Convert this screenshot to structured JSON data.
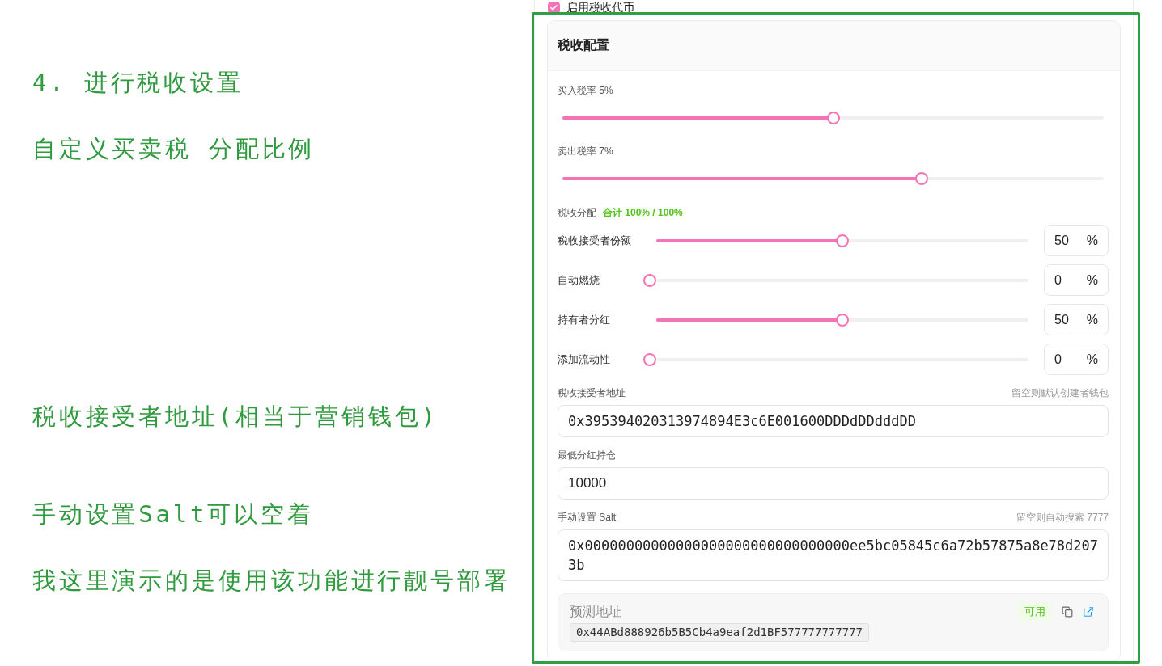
{
  "annotations": [
    "4. 进行税收设置",
    "自定义买卖税 分配比例",
    "税收接受者地址(相当于营销钱包)",
    "手动设置Salt可以空着",
    "我这里演示的是使用该功能进行靓号部署"
  ],
  "enable_tax": {
    "label": "启用税收代币",
    "checked": true
  },
  "tax_config": {
    "title": "税收配置",
    "rates": [
      {
        "label": "买入税率 5%",
        "level": 0.5
      },
      {
        "label": "卖出税率 7%",
        "level": 0.66
      }
    ],
    "distribution": {
      "label": "税收分配",
      "total": "合计 100% / 100%",
      "rows": [
        {
          "label": "税收接受者份额",
          "level": 0.5,
          "value": "50",
          "unit": "%"
        },
        {
          "label": "自动燃烧",
          "level": 0,
          "value": "0",
          "unit": "%"
        },
        {
          "label": "持有者分红",
          "level": 0.5,
          "value": "50",
          "unit": "%"
        },
        {
          "label": "添加流动性",
          "level": 0,
          "value": "0",
          "unit": "%"
        }
      ]
    },
    "fields": [
      {
        "kind": "mono",
        "label": "税收接受者地址",
        "note": "留空则默认创建者钱包",
        "value": "0x395394020313974894E3c6E001600DDDdDDdddDD"
      },
      {
        "kind": "plain",
        "label": "最低分红持仓",
        "value": "10000"
      },
      {
        "kind": "mono",
        "label": "手动设置 Salt",
        "note": "留空则自动搜索 7777",
        "value": "0x00000000000000000000000000000000ee5bc05845c6a72b57875a8e78d2073b"
      }
    ],
    "predicted_address": {
      "label": "预测地址",
      "status": "可用",
      "address": "0x44ABd888926b5B5Cb4a9eaf2d1BF577777777777"
    }
  }
}
